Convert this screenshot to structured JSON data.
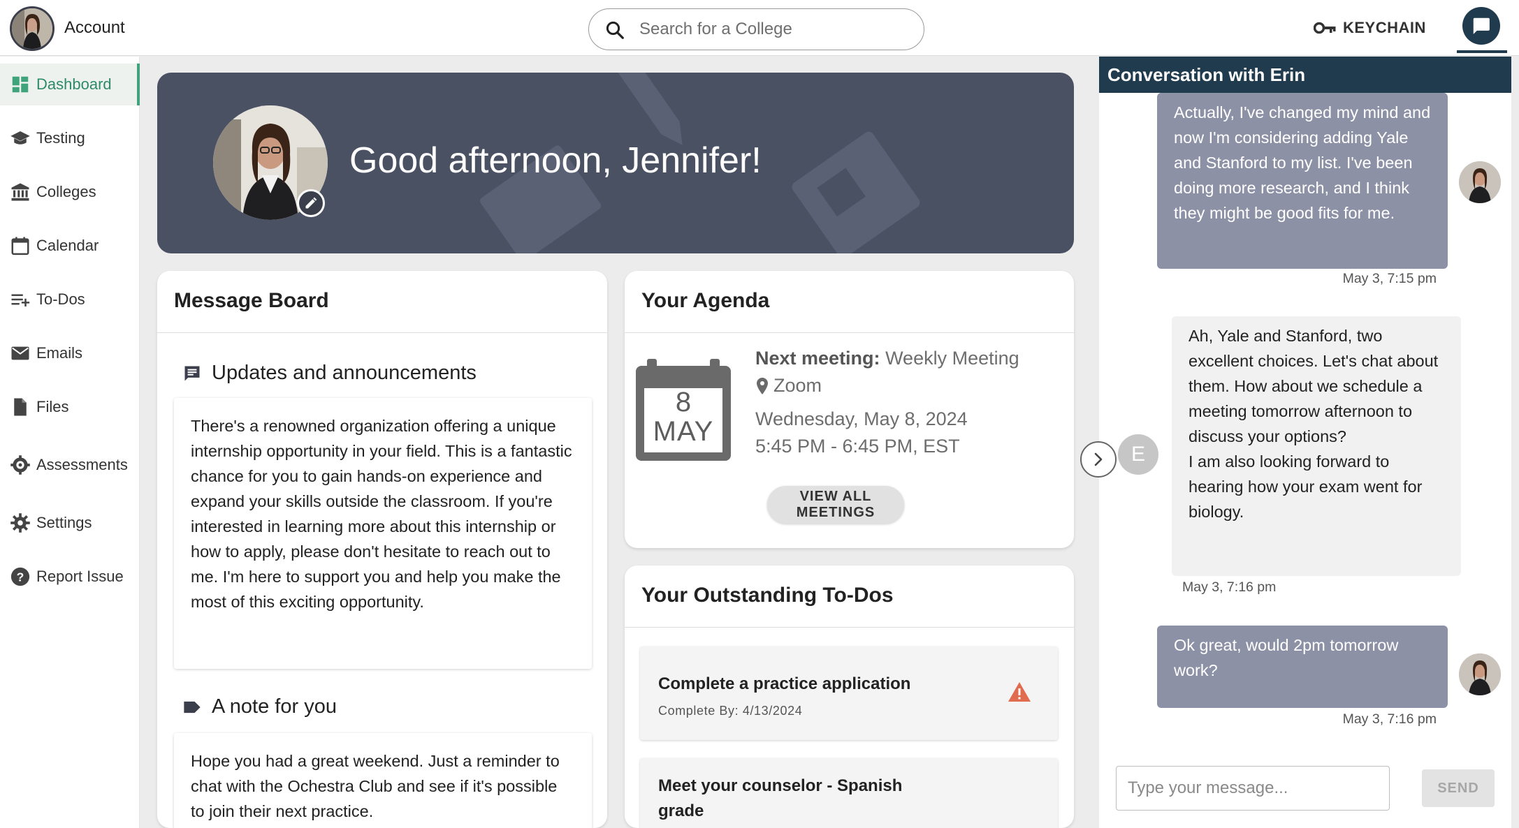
{
  "header": {
    "account_label": "Account",
    "search_placeholder": "Search for a College",
    "keychain_label": "KEYCHAIN"
  },
  "sidebar": {
    "items": [
      {
        "label": "Dashboard",
        "icon": "dashboard-icon",
        "active": true
      },
      {
        "label": "Testing",
        "icon": "graduation-cap-icon"
      },
      {
        "label": "Colleges",
        "icon": "institution-icon"
      },
      {
        "label": "Calendar",
        "icon": "calendar-icon"
      },
      {
        "label": "To-Dos",
        "icon": "playlist-add-icon"
      },
      {
        "label": "Emails",
        "icon": "mail-icon"
      },
      {
        "label": "Files",
        "icon": "file-icon"
      },
      {
        "label": "Assessments",
        "icon": "assessment-gear-icon"
      },
      {
        "label": "Settings",
        "icon": "gear-icon"
      },
      {
        "label": "Report Issue",
        "icon": "help-circle-icon"
      }
    ]
  },
  "banner": {
    "greeting": "Good afternoon, Jennifer!"
  },
  "message_board": {
    "title": "Message Board",
    "sections": [
      {
        "heading": "Updates and announcements",
        "icon": "announcement-icon",
        "body": "There's a renowned organization offering a unique internship opportunity in your field. This is a fantastic chance for you to gain hands-on experience and expand your skills outside the classroom. If you're interested in learning more about this internship or how to apply, please don't hesitate to reach out to me. I'm here to support you and help you make the most of this exciting opportunity."
      },
      {
        "heading": "A note for you",
        "icon": "label-icon",
        "body": "Hope you had a great weekend.  Just a reminder to chat with the Ochestra Club and see if it's possible to join their next practice."
      }
    ]
  },
  "agenda": {
    "title": "Your Agenda",
    "calendar_day": "8",
    "calendar_month": "MAY",
    "next_meeting_label": "Next meeting:",
    "next_meeting_name": "Weekly Meeting",
    "location": "Zoom",
    "date": "Wednesday, May 8, 2024",
    "time": "5:45 PM - 6:45 PM, EST",
    "view_all_label": "VIEW ALL MEETINGS"
  },
  "todos": {
    "title": "Your Outstanding To-Dos",
    "items": [
      {
        "title": "Complete a practice application",
        "due": "Complete By: 4/13/2024",
        "warning": true
      },
      {
        "title": "Meet your counselor - Spanish grade"
      }
    ],
    "warning_color": "#e06b4f"
  },
  "chat": {
    "header": "Conversation with Erin",
    "counselor_initial": "E",
    "messages": [
      {
        "from": "me",
        "text": "Actually, I've changed my mind and now I'm considering adding Yale and Stanford to my list. I've been doing more research, and I think they might be good fits for me.",
        "time": "May 3, 7:15 pm"
      },
      {
        "from": "them",
        "text": "Ah, Yale and Stanford, two excellent choices. Let's chat about them. How about we schedule a meeting tomorrow afternoon to discuss your options?\nI am also looking forward to hearing how your exam went for biology.",
        "time": "May 3, 7:16 pm"
      },
      {
        "from": "me",
        "text": "Ok great, would 2pm tomorrow work?",
        "time": "May 3, 7:16 pm"
      }
    ],
    "input_placeholder": "Type your message...",
    "send_label": "SEND"
  },
  "colors": {
    "accent_green": "#3fa37c",
    "navy": "#1f3b4d",
    "banner": "#4a5163",
    "my_bubble": "#8d91a6"
  }
}
